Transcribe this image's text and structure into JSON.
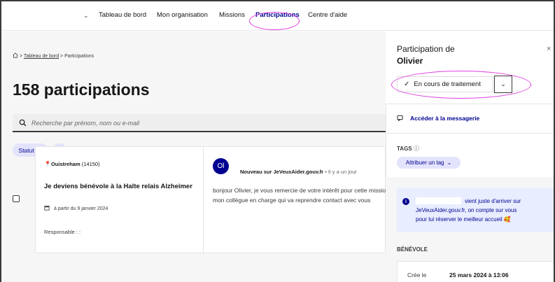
{
  "nav": {
    "items": [
      {
        "label": "Tableau de bord"
      },
      {
        "label": "Mon organisation"
      },
      {
        "label": "Missions"
      },
      {
        "label": "Participations",
        "active": true
      },
      {
        "label": "Centre d'aide"
      }
    ]
  },
  "breadcrumb": {
    "link": "Tableau de bord",
    "current": "Participations",
    "separator": ">"
  },
  "page": {
    "title": "158 participations"
  },
  "search": {
    "placeholder": "Recherche par prénom, nom ou e-mail"
  },
  "filters": {
    "status_label": "Statut",
    "add_label": "+"
  },
  "card": {
    "city": "Ouistreham",
    "postcode": "(14150)",
    "mission_title": "Je deviens bénévole à la Halte relais Alzheimer",
    "date_text": "à partir du 9 janvier 2024",
    "responsable": "Responsable : :",
    "avatar_initials": "Ol",
    "message_sender": "Nouveau sur JeVeuxAider.gouv.fr",
    "message_dot": "•",
    "message_time": "Il y a un jour",
    "message_line1": "bonjour Olivier, je vous remercie de votre intérêt pour cette mission",
    "message_line2": "mon collègue en charge qui va reprendre contact avec vous"
  },
  "panel": {
    "title": "Participation de",
    "name": "Olivier",
    "close": "×",
    "status_label": "En cours de traitement",
    "messaging_link": "Accéder à la messagerie",
    "tags_label": "TAGS",
    "tags_info": "ⓘ",
    "tag_button": "Attribuer un tag",
    "info_line1": "vient juste d'arriver sur",
    "info_line2": "JeVeuxAider.gouv.fr, on compte sur vous",
    "info_line3": "pour lui réserver le meilleur accueil 🥰",
    "benevole_label": "BÉNÉVOLE",
    "created_label": "Crée le",
    "created_value": "25 mars 2024 à 13:06"
  },
  "colors": {
    "primary": "#000091",
    "chip_bg": "#e3e3fd",
    "highlight_ring": "#e040e0"
  }
}
